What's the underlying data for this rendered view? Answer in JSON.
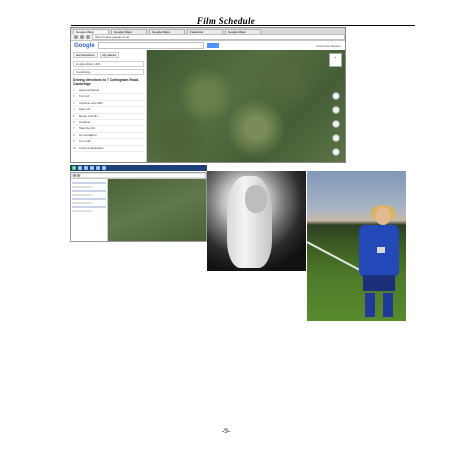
{
  "document": {
    "title": "Film Schedule",
    "page_number": "-9-"
  },
  "screenshot_main": {
    "tabs": [
      "Google Maps",
      "Google Maps",
      "Google Maps",
      "Facebook",
      "Google Maps"
    ],
    "url": "https://maps.google.co.uk",
    "logo": "Google",
    "user": "Christophe Beaton",
    "panel_tabs": [
      "Get directions",
      "My places"
    ],
    "from": "Huddersfield, HD1",
    "to": "Cambridge",
    "route_heading": "Driving directions to 7 Cottingham Road, Cambridge",
    "steps": [
      {
        "n": "1",
        "text": "Head southwest"
      },
      {
        "n": "2",
        "text": "Turn left"
      },
      {
        "n": "3",
        "text": "Continue onto M62"
      },
      {
        "n": "4",
        "text": "Take exit"
      },
      {
        "n": "5",
        "text": "Merge onto M1"
      },
      {
        "n": "6",
        "text": "Continue"
      },
      {
        "n": "7",
        "text": "Take the A14"
      },
      {
        "n": "8",
        "text": "At roundabout"
      },
      {
        "n": "9",
        "text": "Turn right"
      },
      {
        "n": "10",
        "text": "Arrive at destination"
      }
    ],
    "zoom_label": "+"
  },
  "screenshot_small": {
    "url": "maps.google.co.uk"
  },
  "photos": {
    "left": "portrait-black-and-white",
    "right": "girl-in-blue-football-kit"
  }
}
